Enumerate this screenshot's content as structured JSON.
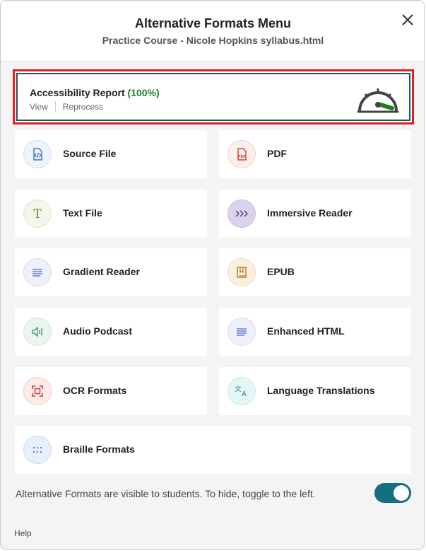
{
  "header": {
    "title": "Alternative Formats Menu",
    "subtitle": "Practice Course - Nicole Hopkins syllabus.html"
  },
  "report": {
    "label": "Accessibility Report",
    "score": "(100%)",
    "view_label": "View",
    "reprocess_label": "Reprocess",
    "icon": "gauge-icon"
  },
  "formats": [
    {
      "label": "Source File",
      "icon": "code-file-icon"
    },
    {
      "label": "PDF",
      "icon": "pdf-icon"
    },
    {
      "label": "Text File",
      "icon": "text-t-icon"
    },
    {
      "label": "Immersive Reader",
      "icon": "chevrons-right-icon"
    },
    {
      "label": "Gradient Reader",
      "icon": "lines-icon"
    },
    {
      "label": "EPUB",
      "icon": "book-icon"
    },
    {
      "label": "Audio Podcast",
      "icon": "speaker-icon"
    },
    {
      "label": "Enhanced HTML",
      "icon": "lines-icon"
    },
    {
      "label": "OCR Formats",
      "icon": "scan-icon"
    },
    {
      "label": "Language Translations",
      "icon": "translate-icon"
    },
    {
      "label": "Braille Formats",
      "icon": "braille-icon"
    }
  ],
  "footer": {
    "visibility_text": "Alternative Formats are visible to students. To hide, toggle to the left.",
    "toggle_on": true,
    "help_label": "Help"
  },
  "colors": {
    "accent": "#156f80",
    "report_score": "#1e7f22",
    "highlight_border": "#e21d24"
  }
}
